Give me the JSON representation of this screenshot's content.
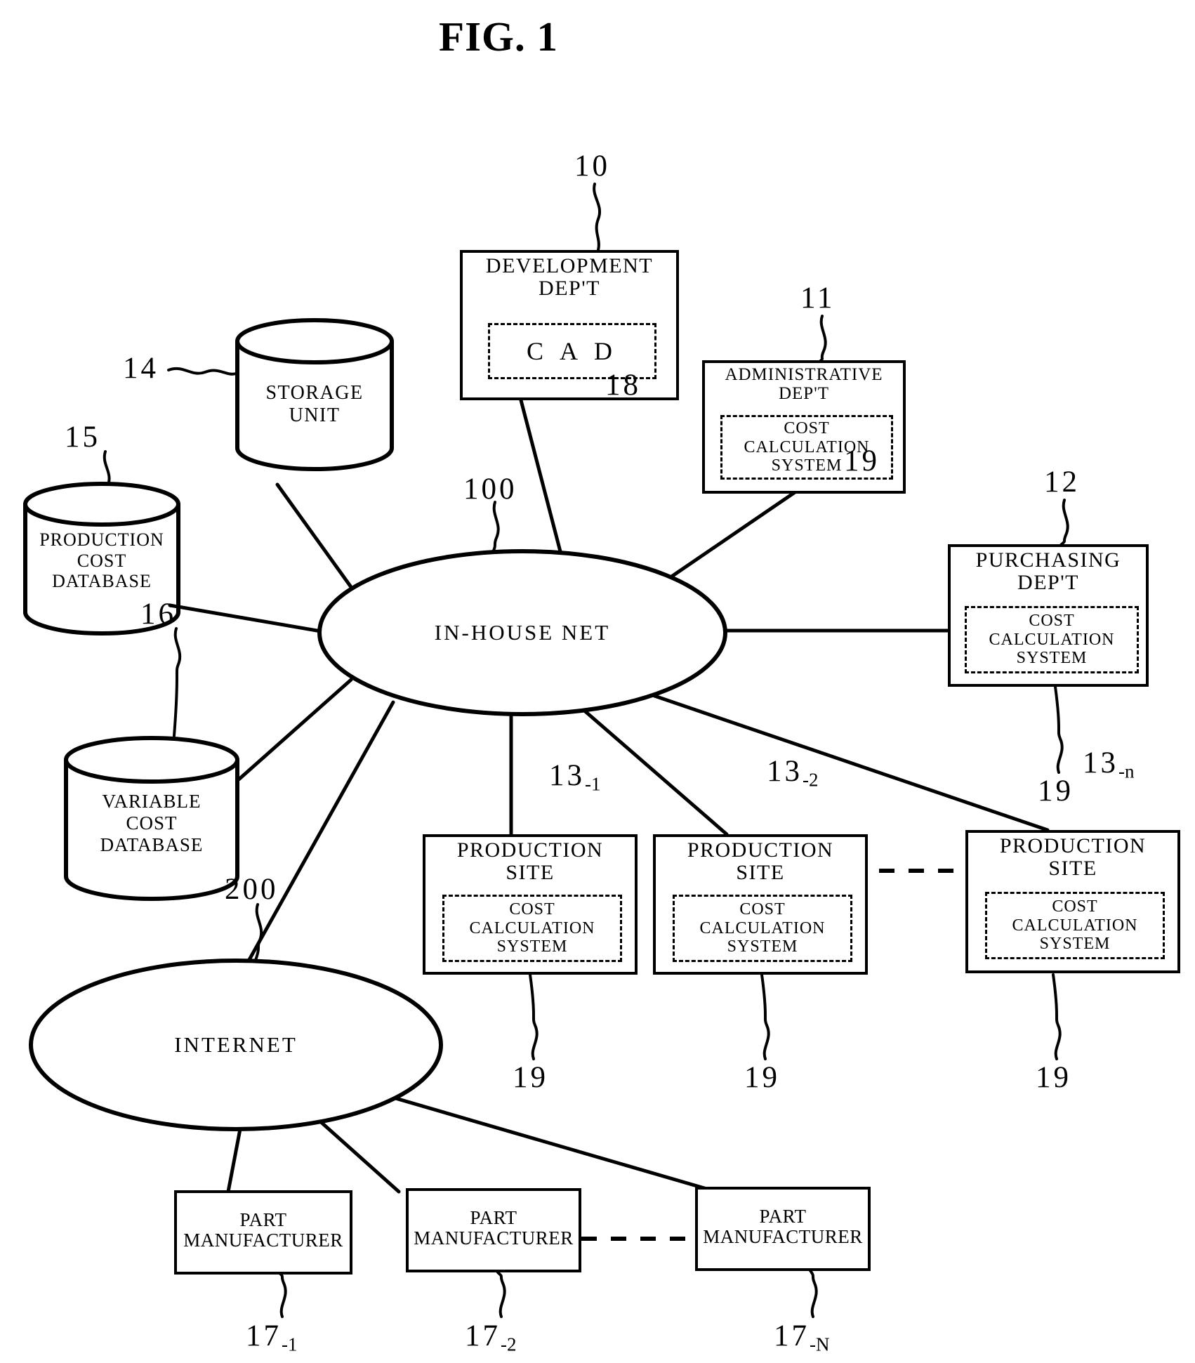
{
  "figure": {
    "title": "FIG. 1"
  },
  "nodes": {
    "development_dept": {
      "title": "DEVELOPMENT\nDEP'T",
      "inner": "C A D",
      "ref": "10",
      "inner_ref": "18"
    },
    "administrative_dept": {
      "title": "ADMINISTRATIVE\nDEP'T",
      "inner": "COST\nCALCULATION\nSYSTEM",
      "ref": "11",
      "inner_ref": "19"
    },
    "purchasing_dept": {
      "title": "PURCHASING\nDEP'T",
      "inner": "COST\nCALCULATION\nSYSTEM",
      "ref": "12",
      "inner_ref": "19"
    },
    "storage_unit": {
      "label": "STORAGE\nUNIT",
      "ref": "14"
    },
    "production_cost_database": {
      "label": "PRODUCTION\nCOST\nDATABASE",
      "ref": "15"
    },
    "variable_cost_database": {
      "label": "VARIABLE\nCOST\nDATABASE",
      "ref": "16"
    },
    "in_house_net": {
      "label": "IN-HOUSE NET",
      "ref": "100"
    },
    "internet": {
      "label": "INTERNET",
      "ref": "200"
    }
  },
  "production_sites": [
    {
      "title": "PRODUCTION\nSITE",
      "inner": "COST\nCALCULATION\nSYSTEM",
      "ref_base": "13",
      "ref_sub": "-1",
      "inner_ref": "19"
    },
    {
      "title": "PRODUCTION\nSITE",
      "inner": "COST\nCALCULATION\nSYSTEM",
      "ref_base": "13",
      "ref_sub": "-2",
      "inner_ref": "19"
    },
    {
      "title": "PRODUCTION\nSITE",
      "inner": "COST\nCALCULATION\nSYSTEM",
      "ref_base": "13",
      "ref_sub": "-n",
      "inner_ref": "19"
    }
  ],
  "part_manufacturers": [
    {
      "label": "PART\nMANUFACTURER",
      "ref_base": "17",
      "ref_sub": "-1"
    },
    {
      "label": "PART\nMANUFACTURER",
      "ref_base": "17",
      "ref_sub": "-2"
    },
    {
      "label": "PART\nMANUFACTURER",
      "ref_base": "17",
      "ref_sub": "-N"
    }
  ],
  "colors": {
    "ink": "#000000",
    "paper": "#ffffff"
  }
}
